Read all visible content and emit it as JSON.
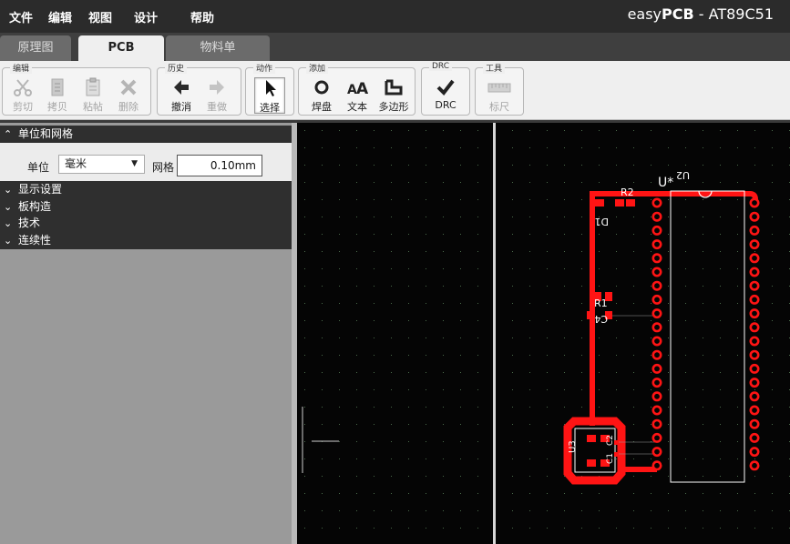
{
  "menubar": {
    "items": [
      "文件",
      "编辑",
      "视图",
      "设计",
      "帮助"
    ],
    "brand_prefix": "easy",
    "brand_strong": "PCB",
    "doc_title": " - AT89C51"
  },
  "tabs": [
    "原理图",
    "PCB",
    "物料单"
  ],
  "toolbar": {
    "groups": {
      "edit": "编辑",
      "history": "历史",
      "action": "动作",
      "add": "添加",
      "drc": "DRC",
      "tools": "工具"
    },
    "buttons": {
      "cut": "剪切",
      "copy": "拷贝",
      "paste": "粘帖",
      "delete": "删除",
      "undo": "撤消",
      "redo": "重做",
      "select": "选择",
      "pad": "焊盘",
      "text": "文本",
      "polygon": "多边形",
      "drc": "DRC",
      "ruler": "标尺"
    }
  },
  "panel": {
    "units_grid_title": "单位和网格",
    "unit_label": "单位",
    "unit_value": "毫米",
    "grid_label": "网格",
    "grid_value": "0.10mm",
    "display_settings": "显示设置",
    "board_construction": "板构造",
    "technology": "技术",
    "connectivity": "连续性"
  },
  "board": {
    "labels": {
      "u_star": "U*",
      "u2": "U2",
      "r2": "R2",
      "d1": "D1",
      "r1": "R1",
      "c4": "C4",
      "u3": "U3",
      "c2": "C2",
      "c1": "C1"
    }
  },
  "colors": {
    "menubar_bg": "#2b2b2b",
    "canvas_bg": "#050505",
    "copper_red": "#ff1414",
    "silkscreen": "#ffffff"
  }
}
